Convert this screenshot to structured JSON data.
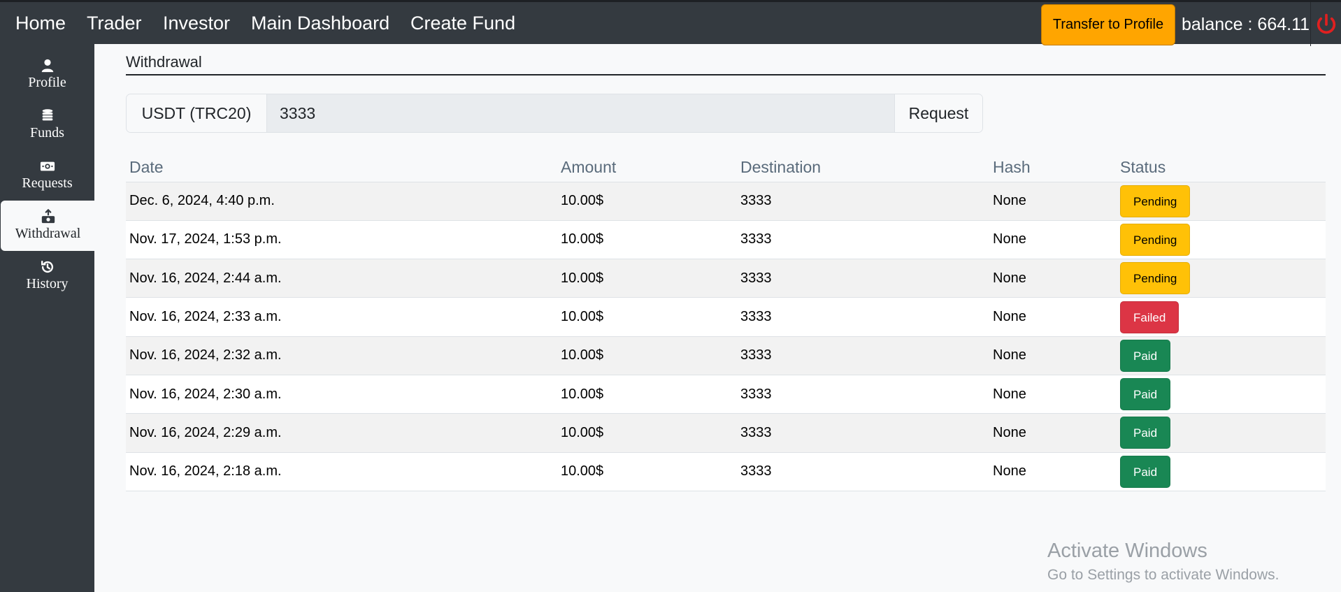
{
  "nav": {
    "links": [
      "Home",
      "Trader",
      "Investor",
      "Main Dashboard",
      "Create Fund"
    ],
    "transfer_label": "Transfer to Profile",
    "balance_label": "balance : 664.11"
  },
  "sidebar": {
    "items": [
      {
        "label": "Profile",
        "icon": "user-icon"
      },
      {
        "label": "Funds",
        "icon": "coins-icon"
      },
      {
        "label": "Requests",
        "icon": "money-bill-icon"
      },
      {
        "label": "Withdrawal",
        "icon": "withdraw-icon",
        "active": true
      },
      {
        "label": "History",
        "icon": "history-icon"
      }
    ]
  },
  "main": {
    "title": "Withdrawal",
    "currency": "USDT (TRC20)",
    "amount_value": "3333",
    "request_label": "Request"
  },
  "table": {
    "headers": [
      "Date",
      "Amount",
      "Destination",
      "Hash",
      "Status"
    ],
    "rows": [
      {
        "date": "Dec. 6, 2024, 4:40 p.m.",
        "amount": "10.00$",
        "destination": "3333",
        "hash": "None",
        "status": "Pending"
      },
      {
        "date": "Nov. 17, 2024, 1:53 p.m.",
        "amount": "10.00$",
        "destination": "3333",
        "hash": "None",
        "status": "Pending"
      },
      {
        "date": "Nov. 16, 2024, 2:44 a.m.",
        "amount": "10.00$",
        "destination": "3333",
        "hash": "None",
        "status": "Pending"
      },
      {
        "date": "Nov. 16, 2024, 2:33 a.m.",
        "amount": "10.00$",
        "destination": "3333",
        "hash": "None",
        "status": "Failed"
      },
      {
        "date": "Nov. 16, 2024, 2:32 a.m.",
        "amount": "10.00$",
        "destination": "3333",
        "hash": "None",
        "status": "Paid"
      },
      {
        "date": "Nov. 16, 2024, 2:30 a.m.",
        "amount": "10.00$",
        "destination": "3333",
        "hash": "None",
        "status": "Paid"
      },
      {
        "date": "Nov. 16, 2024, 2:29 a.m.",
        "amount": "10.00$",
        "destination": "3333",
        "hash": "None",
        "status": "Paid"
      },
      {
        "date": "Nov. 16, 2024, 2:18 a.m.",
        "amount": "10.00$",
        "destination": "3333",
        "hash": "None",
        "status": "Paid"
      }
    ]
  },
  "watermark": {
    "title": "Activate Windows",
    "subtitle": "Go to Settings to activate Windows."
  },
  "colors": {
    "topbar": "#343a40",
    "transfer_button": "#ffa500",
    "power_icon": "#e02020",
    "pending": "#ffc107",
    "failed": "#dc3545",
    "paid": "#198754"
  }
}
